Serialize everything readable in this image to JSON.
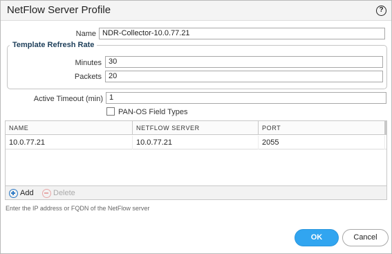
{
  "dialog": {
    "title": "NetFlow Server Profile",
    "help_icon": "?"
  },
  "form": {
    "name_label": "Name",
    "name_value": "NDR-Collector-10.0.77.21",
    "refresh_legend": "Template Refresh Rate",
    "minutes_label": "Minutes",
    "minutes_value": "30",
    "packets_label": "Packets",
    "packets_value": "20",
    "timeout_label": "Active Timeout (min)",
    "timeout_value": "1",
    "panos_label": "PAN-OS Field Types",
    "panos_checked": false
  },
  "table": {
    "columns": [
      "NAME",
      "NETFLOW SERVER",
      "PORT"
    ],
    "rows": [
      [
        "10.0.77.21",
        "10.0.77.21",
        "2055"
      ]
    ]
  },
  "toolbar": {
    "add_label": "Add",
    "delete_label": "Delete"
  },
  "hint": "Enter the IP address or FQDN of the NetFlow server",
  "buttons": {
    "ok_label": "OK",
    "cancel_label": "Cancel"
  },
  "colors": {
    "ok_bg": "#31a5f0",
    "legend_text": "#1e3f5a",
    "add_icon": "#2b78c5",
    "delete_icon": "#e7a7a7"
  },
  "icons": [
    "help-icon",
    "add-icon",
    "delete-icon"
  ]
}
